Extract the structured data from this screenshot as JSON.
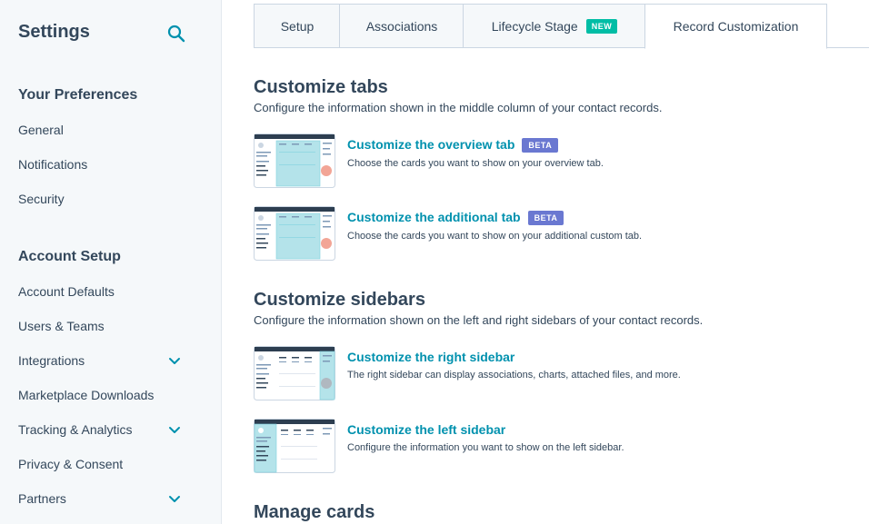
{
  "sidebar": {
    "title": "Settings",
    "sections": [
      {
        "label": "Your Preferences",
        "items": [
          "General",
          "Notifications",
          "Security"
        ]
      },
      {
        "label": "Account Setup",
        "items": [
          "Account Defaults",
          "Users & Teams",
          "Integrations",
          "Marketplace Downloads",
          "Tracking & Analytics",
          "Privacy & Consent",
          "Partners"
        ]
      }
    ]
  },
  "tabs": [
    {
      "label": "Setup"
    },
    {
      "label": "Associations"
    },
    {
      "label": "Lifecycle Stage",
      "badge": "NEW"
    },
    {
      "label": "Record Customization",
      "active": true
    }
  ],
  "main": {
    "tabs_section": {
      "heading": "Customize tabs",
      "description": "Configure the information shown in the middle column of your contact records.",
      "cards": [
        {
          "title": "Customize the overview tab",
          "badge": "BETA",
          "description": "Choose the cards you want to show on your overview tab."
        },
        {
          "title": "Customize the additional tab",
          "badge": "BETA",
          "description": "Choose the cards you want to show on your additional custom tab."
        }
      ]
    },
    "sidebars_section": {
      "heading": "Customize sidebars",
      "description": "Configure the information shown on the left and right sidebars of your contact records.",
      "cards": [
        {
          "title": "Customize the right sidebar",
          "description": "The right sidebar can display associations, charts, attached files, and more."
        },
        {
          "title": "Customize the left sidebar",
          "description": "Configure the information you want to show on the left sidebar."
        }
      ]
    },
    "cards_section": {
      "heading": "Manage cards"
    }
  },
  "colors": {
    "link": "#0091ae",
    "text": "#33475b",
    "new_badge": "#00bda5",
    "beta_badge": "#6a78d1",
    "sidebar_bg": "#f5f8fa"
  }
}
